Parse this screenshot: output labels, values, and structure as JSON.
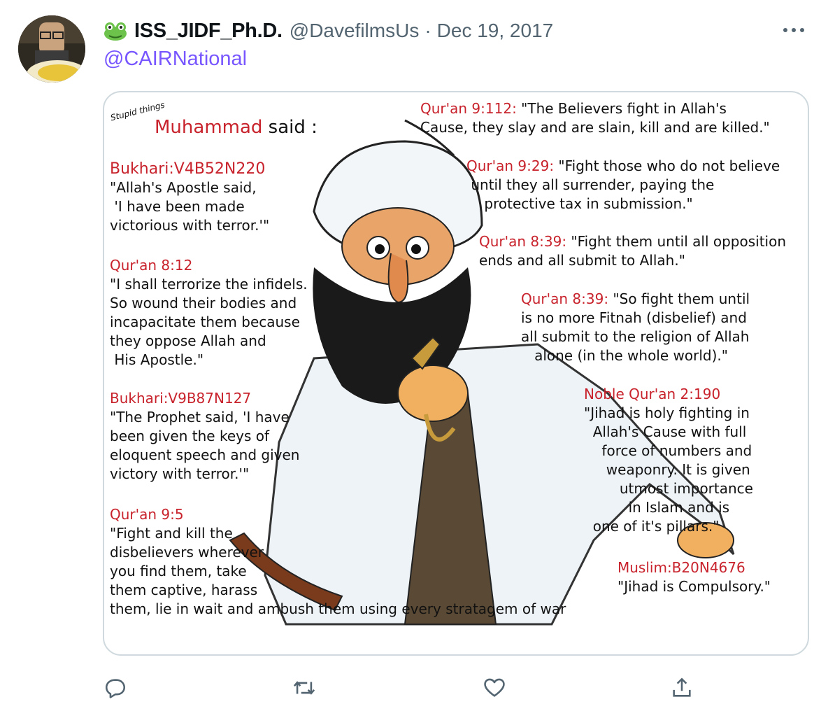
{
  "tweet": {
    "display_name": "ISS_JIDF_Ph.D.",
    "handle": "@DavefilmsUs",
    "separator": "·",
    "date": "Dec 19, 2017",
    "reply_to": "@CAIRNational",
    "emoji_icon": "frog-face-icon",
    "colors": {
      "accent": "#7856ff",
      "muted": "#536471",
      "border": "#cfd9de",
      "quote_red": "#c8232c"
    }
  },
  "image": {
    "corner_note": "Stupid things",
    "heading_name": "Muhammad",
    "heading_rest": " said :",
    "left_blocks": [
      {
        "ref": "Bukhari:V4B52N220",
        "lines": [
          "\"Allah's Apostle said,",
          " 'I have been made",
          "victorious with terror.'\""
        ]
      },
      {
        "ref": "Qur'an 8:12",
        "lines": [
          "\"I shall terrorize the infidels.",
          "So wound their bodies and",
          "incapacitate them because",
          "they oppose Allah and",
          " His Apostle.\""
        ]
      },
      {
        "ref": "Bukhari:V9B87N127",
        "lines": [
          "\"The Prophet said, 'I have",
          "been given the keys of",
          "eloquent speech and given",
          "victory with terror.'\""
        ]
      },
      {
        "ref": "Qur'an 9:5",
        "lines": [
          "\"Fight and kill the",
          "disbelievers wherever",
          "you find them, take",
          "them captive, harass",
          "them, lie in wait and ambush them using every stratagem of war"
        ]
      }
    ],
    "right_blocks": [
      {
        "ref": "Qur'an 9:112:",
        "lines": [
          " \"The Believers fight in Allah's",
          "Cause, they slay and are slain, kill and are killed.\""
        ]
      },
      {
        "ref": "Qur'an 9:29:",
        "lines": [
          " \"Fight those who do not believe",
          " until they all surrender, paying the",
          "    protective tax in submission.\""
        ]
      },
      {
        "ref": "Qur'an 8:39:",
        "lines": [
          " \"Fight them until all opposition",
          "ends and all submit to Allah.\""
        ]
      },
      {
        "ref": "Qur'an 8:39:",
        "lines": [
          " \"So fight them until",
          "is no more Fitnah (disbelief) and",
          "all submit to the religion of Allah",
          "   alone (in the whole world).\""
        ]
      },
      {
        "ref": "Noble Qur'an 2:190",
        "lines": [
          "\"Jihad is holy fighting in",
          "  Allah's Cause with full",
          "    force of numbers and",
          "     weaponry. It is given",
          "        utmost importance",
          "          in Islam and is",
          "  one of it's pillars.\""
        ]
      },
      {
        "ref": "Muslim:B20N4676",
        "lines": [
          "\"Jihad is Compulsory.\""
        ]
      }
    ]
  },
  "actions": {
    "reply": "reply-icon",
    "retweet": "retweet-icon",
    "like": "heart-icon",
    "share": "share-icon"
  }
}
